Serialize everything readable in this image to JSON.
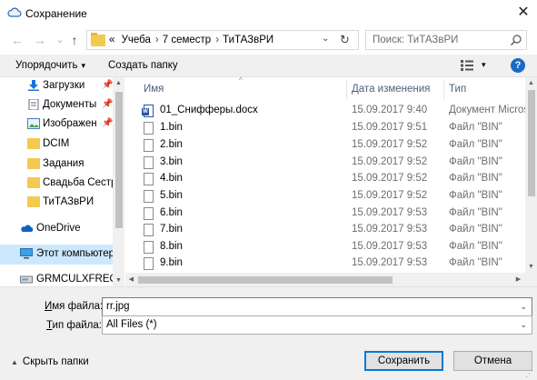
{
  "window": {
    "title": "Сохранение",
    "close_glyph": "✕"
  },
  "nav": {
    "back_glyph": "←",
    "forward_glyph": "→",
    "recent_glyph": "⌄",
    "up_glyph": "↑"
  },
  "address": {
    "chevrons": "«",
    "crumbs": [
      "Учеба",
      "7 семестр",
      "ТиТАЗвРИ"
    ],
    "separator": "›",
    "dropdown_glyph": "⌄",
    "refresh_glyph": "↻"
  },
  "search": {
    "placeholder": "Поиск: ТиТАЗвРИ"
  },
  "toolbar": {
    "organize_label": "Упорядочить",
    "new_folder_label": "Создать папку",
    "help_label": "?",
    "caret": "▾"
  },
  "sidebar": {
    "pin_glyph": "📌",
    "items": [
      {
        "label": "Загрузки",
        "icon": "download-icon",
        "pinned": true
      },
      {
        "label": "Документы",
        "icon": "documents-icon",
        "pinned": true
      },
      {
        "label": "Изображени",
        "icon": "pictures-icon",
        "pinned": true
      },
      {
        "label": "DCIM",
        "icon": "folder-icon",
        "pinned": false
      },
      {
        "label": "Задания",
        "icon": "folder-icon",
        "pinned": false
      },
      {
        "label": "Свадьба Сестре",
        "icon": "folder-icon",
        "pinned": false
      },
      {
        "label": "ТиТАЗвРИ",
        "icon": "folder-icon",
        "pinned": false
      },
      {
        "label": "OneDrive",
        "icon": "onedrive-icon",
        "pinned": false
      },
      {
        "label": "Этот компьютер",
        "icon": "computer-icon",
        "pinned": false,
        "selected": true
      },
      {
        "label": "GRMCULXFREO_R",
        "icon": "drive-icon",
        "pinned": false
      }
    ]
  },
  "filelist": {
    "columns": [
      "Имя",
      "Дата изменения",
      "Тип"
    ],
    "sort_glyph": "^",
    "rows": [
      {
        "name": "01_Снифферы.docx",
        "date": "15.09.2017 9:40",
        "type": "Документ Micros",
        "kind": "docx"
      },
      {
        "name": "1.bin",
        "date": "15.09.2017 9:51",
        "type": "Файл \"BIN\"",
        "kind": "bin"
      },
      {
        "name": "2.bin",
        "date": "15.09.2017 9:52",
        "type": "Файл \"BIN\"",
        "kind": "bin"
      },
      {
        "name": "3.bin",
        "date": "15.09.2017 9:52",
        "type": "Файл \"BIN\"",
        "kind": "bin"
      },
      {
        "name": "4.bin",
        "date": "15.09.2017 9:52",
        "type": "Файл \"BIN\"",
        "kind": "bin"
      },
      {
        "name": "5.bin",
        "date": "15.09.2017 9:52",
        "type": "Файл \"BIN\"",
        "kind": "bin"
      },
      {
        "name": "6.bin",
        "date": "15.09.2017 9:53",
        "type": "Файл \"BIN\"",
        "kind": "bin"
      },
      {
        "name": "7.bin",
        "date": "15.09.2017 9:53",
        "type": "Файл \"BIN\"",
        "kind": "bin"
      },
      {
        "name": "8.bin",
        "date": "15.09.2017 9:53",
        "type": "Файл \"BIN\"",
        "kind": "bin"
      },
      {
        "name": "9.bin",
        "date": "15.09.2017 9:53",
        "type": "Файл \"BIN\"",
        "kind": "bin"
      }
    ]
  },
  "scroll": {
    "up_glyph": "▲",
    "down_glyph": "▼",
    "left_glyph": "◀",
    "right_glyph": "▶"
  },
  "form": {
    "filename_label_accel": "И",
    "filename_label_rest": "мя файла:",
    "filename_value": "rr.jpg",
    "filetype_label_accel": "Т",
    "filetype_label_rest": "ип файла:",
    "filetype_value": "All Files (*)",
    "dropdown_glyph": "⌄"
  },
  "footer": {
    "hide_folders_label": "Скрыть папки",
    "hide_folders_glyph": "▲",
    "save_label": "Сохранить",
    "cancel_label": "Отмена",
    "grip_glyph": "⋰"
  },
  "colors": {
    "accent": "#0078d7",
    "selection": "#cce8ff",
    "folder": "#f4c94f",
    "help": "#1b6ac9"
  }
}
